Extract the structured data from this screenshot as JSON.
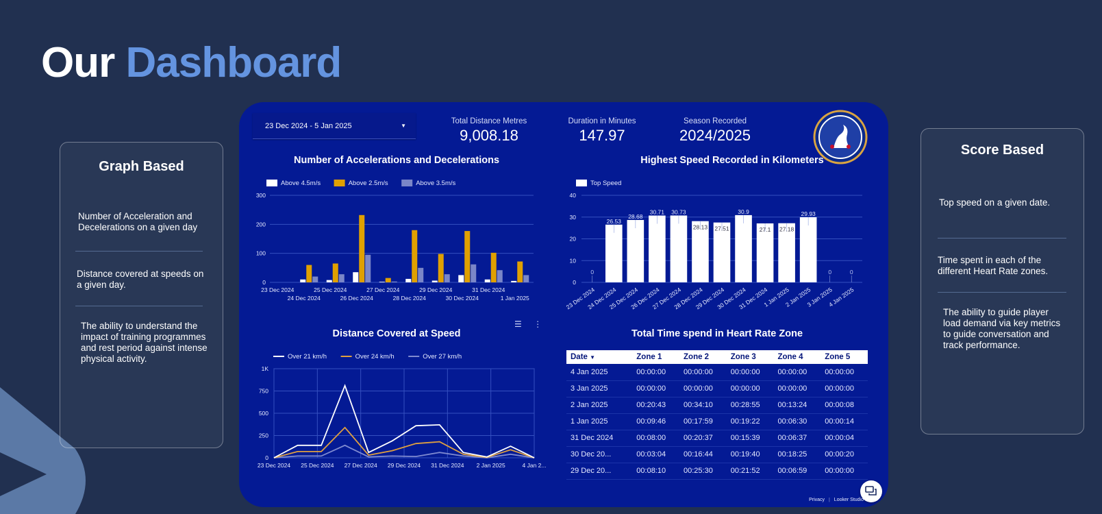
{
  "page": {
    "title_part1": "Our",
    "title_part2": "Dashboard"
  },
  "colors": {
    "background": "#213050",
    "accent": "#6494e0",
    "dashboard": "#041a94",
    "bar_white": "#ffffff",
    "bar_gold": "#e0a000",
    "bar_blue": "#7a86c8"
  },
  "graph_card": {
    "title": "Graph Based",
    "items": [
      "Number of Acceleration and Decelerations on a given day",
      "Distance covered at speeds on a given day.",
      "The ability to understand the impact of training programmes and rest period against intense physical activity."
    ]
  },
  "score_card": {
    "title": "Score Based",
    "items": [
      "Top speed on a given date.",
      "Time spent in each of the different Heart Rate zones.",
      "The ability to guide player load demand via key metrics to guide conversation and track performance."
    ]
  },
  "dashboard": {
    "date_range": "23 Dec 2024 - 5 Jan 2025",
    "kpis": [
      {
        "label": "Total Distance Metres",
        "value": "9,008.18"
      },
      {
        "label": "Duration in Minutes",
        "value": "147.97"
      },
      {
        "label": "Season Recorded",
        "value": "2024/2025"
      }
    ],
    "crest_icon": "chelsea-crest",
    "footer_privacy": "Privacy",
    "footer_looker": "Looker Studio"
  },
  "chart_data": [
    {
      "type": "bar",
      "title": "Number of Accelerations and Decelerations",
      "categories": [
        "23 Dec 2024",
        "24 Dec 2024",
        "25 Dec 2024",
        "26 Dec 2024",
        "27 Dec 2024",
        "28 Dec 2024",
        "29 Dec 2024",
        "30 Dec 2024",
        "31 Dec 2024",
        "1 Jan 2025"
      ],
      "series": [
        {
          "name": "Above 4.5m/s",
          "values": [
            0,
            10,
            8,
            35,
            2,
            12,
            6,
            25,
            10,
            5
          ]
        },
        {
          "name": "Above 2.5m/s",
          "values": [
            0,
            60,
            65,
            232,
            15,
            180,
            98,
            177,
            102,
            72
          ]
        },
        {
          "name": "Above 3.5m/s",
          "values": [
            0,
            20,
            28,
            95,
            3,
            50,
            28,
            62,
            42,
            25
          ]
        }
      ],
      "yticks": [
        "0",
        "100",
        "200",
        "300"
      ],
      "ylim": [
        0,
        300
      ],
      "legend": "top-left"
    },
    {
      "type": "bar",
      "title": "Highest Speed Recorded in Kilometers",
      "categories": [
        "23 Dec 2024",
        "24 Dec 2024",
        "25 Dec 2024",
        "26 Dec 2024",
        "27 Dec 2024",
        "28 Dec 2024",
        "29 Dec 2024",
        "30 Dec 2024",
        "31 Dec 2024",
        "1 Jan 2025",
        "2 Jan 2025",
        "3 Jan 2025",
        "4 Jan 2025"
      ],
      "series": [
        {
          "name": "Top Speed",
          "values": [
            0,
            26.53,
            28.68,
            30.71,
            30.73,
            28.13,
            27.51,
            30.9,
            27.1,
            27.18,
            29.93,
            0,
            0
          ]
        }
      ],
      "yticks": [
        "0",
        "10",
        "20",
        "30",
        "40"
      ],
      "ylim": [
        0,
        40
      ],
      "legend": "top-left"
    },
    {
      "type": "line",
      "title": "Distance Covered at Speed",
      "x_labels": [
        "23 Dec 2024",
        "25 Dec 2024",
        "27 Dec 2024",
        "29 Dec 2024",
        "31 Dec 2024",
        "2 Jan 2025",
        "4 Jan 2..."
      ],
      "series": [
        {
          "name": "Over 21 km/h",
          "values": [
            0,
            140,
            140,
            810,
            60,
            190,
            360,
            370,
            60,
            10,
            130,
            0
          ]
        },
        {
          "name": "Over 24 km/h",
          "values": [
            0,
            70,
            70,
            340,
            30,
            80,
            160,
            180,
            40,
            5,
            90,
            0
          ]
        },
        {
          "name": "Over 27 km/h",
          "values": [
            0,
            20,
            20,
            140,
            10,
            20,
            15,
            60,
            20,
            0,
            40,
            0
          ]
        }
      ],
      "yticks": [
        "0",
        "250",
        "500",
        "750",
        "1K"
      ],
      "ylim": [
        0,
        1000
      ],
      "legend": "top-left"
    },
    {
      "type": "table",
      "title": "Total Time spend in Heart Rate Zone",
      "columns": [
        "Date",
        "Zone 1",
        "Zone 2",
        "Zone 3",
        "Zone 4",
        "Zone 5"
      ],
      "sort_marker": "▼",
      "rows": [
        [
          "4 Jan 2025",
          "00:00:00",
          "00:00:00",
          "00:00:00",
          "00:00:00",
          "00:00:00"
        ],
        [
          "3 Jan 2025",
          "00:00:00",
          "00:00:00",
          "00:00:00",
          "00:00:00",
          "00:00:00"
        ],
        [
          "2 Jan 2025",
          "00:20:43",
          "00:34:10",
          "00:28:55",
          "00:13:24",
          "00:00:08"
        ],
        [
          "1 Jan 2025",
          "00:09:46",
          "00:17:59",
          "00:19:22",
          "00:06:30",
          "00:00:14"
        ],
        [
          "31 Dec 2024",
          "00:08:00",
          "00:20:37",
          "00:15:39",
          "00:06:37",
          "00:00:04"
        ],
        [
          "30 Dec 20...",
          "00:03:04",
          "00:16:44",
          "00:19:40",
          "00:18:25",
          "00:00:20"
        ],
        [
          "29 Dec 20...",
          "00:08:10",
          "00:25:30",
          "00:21:52",
          "00:06:59",
          "00:00:00"
        ]
      ]
    }
  ]
}
